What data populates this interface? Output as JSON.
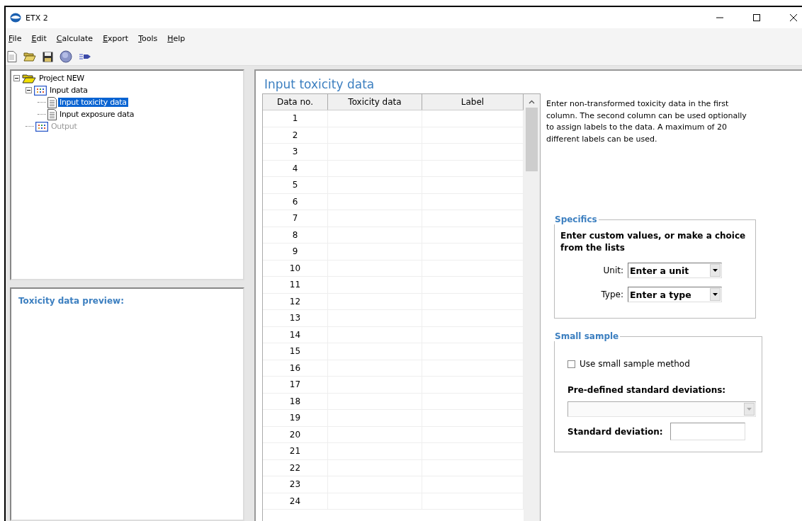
{
  "window": {
    "title": "ETX 2"
  },
  "menu": [
    "File",
    "Edit",
    "Calculate",
    "Export",
    "Tools",
    "Help"
  ],
  "toolbar": [
    {
      "kind": "new"
    },
    {
      "kind": "open"
    },
    {
      "kind": "save"
    },
    {
      "kind": "help"
    },
    {
      "kind": "run"
    }
  ],
  "tree": [
    {
      "label": "Project NEW",
      "kind": "project",
      "expanded": true,
      "selected": false,
      "disabled": false,
      "children": [
        {
          "label": "Input data",
          "kind": "group",
          "expanded": true,
          "selected": false,
          "disabled": false,
          "children": [
            {
              "label": "Input toxicity data",
              "kind": "doc",
              "selected": true,
              "disabled": false
            },
            {
              "label": "Input exposure data",
              "kind": "doc",
              "selected": false,
              "disabled": false
            }
          ]
        },
        {
          "label": "Output",
          "kind": "group",
          "selected": false,
          "disabled": true
        }
      ]
    }
  ],
  "preview": {
    "title": "Toxicity data preview:"
  },
  "main": {
    "title": "Input toxicity data",
    "table": {
      "columns": [
        "Data no.",
        "Toxicity data",
        "Label"
      ],
      "rows": [
        "1",
        "2",
        "3",
        "4",
        "5",
        "6",
        "7",
        "8",
        "9",
        "10",
        "11",
        "12",
        "13",
        "14",
        "15",
        "16",
        "17",
        "18",
        "19",
        "20",
        "21",
        "22",
        "23",
        "24"
      ]
    },
    "help_text": "Enter non-transformed toxicity data in the first column. The second column can be used optionally to assign labels to the data. A maximum of 20 different labels can be used.",
    "specifics": {
      "legend": "Specifics",
      "intro": "Enter custom values, or make a choice from the lists",
      "fields": [
        {
          "label": "Unit:",
          "value": "Enter a unit"
        },
        {
          "label": "Type:",
          "value": "Enter a type"
        }
      ]
    },
    "small_sample": {
      "legend": "Small sample",
      "checkbox": {
        "label": "Use small sample method",
        "checked": false
      },
      "predefined_label": "Pre-defined standard deviations:",
      "predefined_disabled": true,
      "sd_label": "Standard deviation:"
    }
  }
}
